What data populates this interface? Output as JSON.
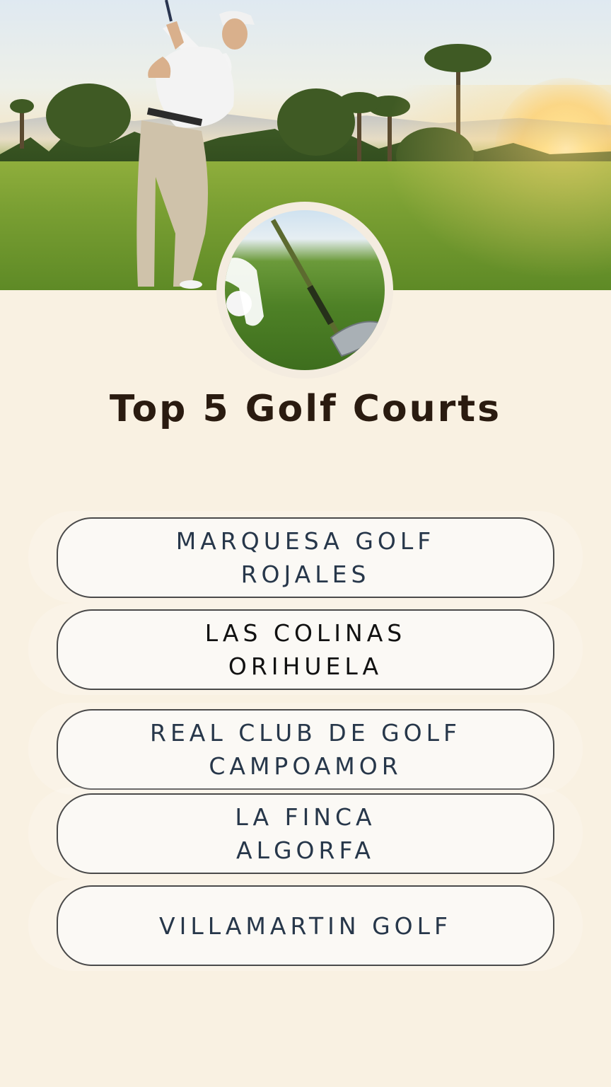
{
  "page": {
    "title": "Top 5 Golf Courts"
  },
  "hero": {
    "image": "golfer-swinging-on-course-at-sunset"
  },
  "medallion": {
    "image": "golf-club-and-ball-closeup"
  },
  "courses": [
    {
      "line1": "MARQUESA GOLF",
      "line2": "ROJALES"
    },
    {
      "line1": "LAS COLINAS",
      "line2": "ORIHUELA"
    },
    {
      "line1": "REAL CLUB DE GOLF",
      "line2": "CAMPOAMOR"
    },
    {
      "line1": "LA FINCA",
      "line2": "ALGORFA"
    },
    {
      "line1": "VILLAMARTIN GOLF",
      "line2": ""
    }
  ],
  "colors": {
    "background": "#f9f1e2",
    "button_fill": "#fbf9f5",
    "button_border": "#4a4a4a",
    "button_text": "#27374a",
    "title_text": "#2a1b10"
  }
}
